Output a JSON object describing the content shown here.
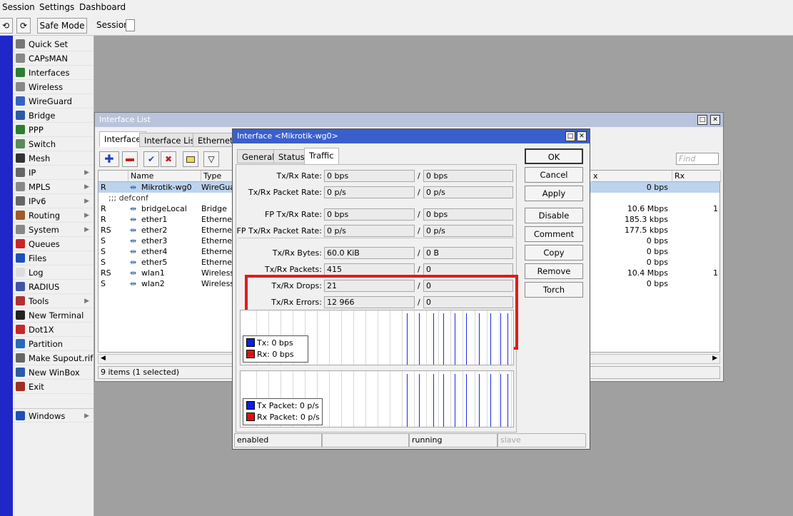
{
  "menu": {
    "session": "Session",
    "settings": "Settings",
    "dashboard": "Dashboard"
  },
  "toolbar": {
    "safe_mode": "Safe Mode",
    "session_label": "Session:"
  },
  "sidebar": {
    "items": [
      {
        "label": "Quick Set",
        "icon": "wand-icon",
        "color": "#777"
      },
      {
        "label": "CAPsMAN",
        "icon": "antenna-icon",
        "color": "#888"
      },
      {
        "label": "Interfaces",
        "icon": "interfaces-icon",
        "color": "#2e7d32"
      },
      {
        "label": "Wireless",
        "icon": "wireless-icon",
        "color": "#888"
      },
      {
        "label": "WireGuard",
        "icon": "wireguard-icon",
        "color": "#3561c4"
      },
      {
        "label": "Bridge",
        "icon": "bridge-icon",
        "color": "#2a5aa8"
      },
      {
        "label": "PPP",
        "icon": "ppp-icon",
        "color": "#2e7d32"
      },
      {
        "label": "Switch",
        "icon": "switch-icon",
        "color": "#5a8a5a"
      },
      {
        "label": "Mesh",
        "icon": "mesh-icon",
        "color": "#333"
      },
      {
        "label": "IP",
        "icon": "ip-icon",
        "color": "#666",
        "arrow": true
      },
      {
        "label": "MPLS",
        "icon": "mpls-icon",
        "color": "#888",
        "arrow": true
      },
      {
        "label": "IPv6",
        "icon": "ipv6-icon",
        "color": "#666",
        "arrow": true
      },
      {
        "label": "Routing",
        "icon": "routing-icon",
        "color": "#a05a2c",
        "arrow": true
      },
      {
        "label": "System",
        "icon": "gear-icon",
        "color": "#888",
        "arrow": true
      },
      {
        "label": "Queues",
        "icon": "queues-icon",
        "color": "#c62828"
      },
      {
        "label": "Files",
        "icon": "folder-icon",
        "color": "#1f4fb8"
      },
      {
        "label": "Log",
        "icon": "log-icon",
        "color": "#ddd"
      },
      {
        "label": "RADIUS",
        "icon": "radius-icon",
        "color": "#4055a8"
      },
      {
        "label": "Tools",
        "icon": "tools-icon",
        "color": "#b03030",
        "arrow": true
      },
      {
        "label": "New Terminal",
        "icon": "terminal-icon",
        "color": "#222"
      },
      {
        "label": "Dot1X",
        "icon": "dot1x-icon",
        "color": "#c62828"
      },
      {
        "label": "Partition",
        "icon": "partition-icon",
        "color": "#2a6ab8"
      },
      {
        "label": "Make Supout.rif",
        "icon": "supout-icon",
        "color": "#666"
      },
      {
        "label": "New WinBox",
        "icon": "winbox-icon",
        "color": "#2a5aa8"
      },
      {
        "label": "Exit",
        "icon": "exit-icon",
        "color": "#a03020"
      }
    ],
    "windows": {
      "label": "Windows",
      "icon": "windows-icon",
      "color": "#1f4fb8"
    }
  },
  "interface_list": {
    "title": "Interface List",
    "tabs": [
      "Interface",
      "Interface List",
      "Ethernet"
    ],
    "find_placeholder": "Find",
    "columns": {
      "flag": "",
      "name": "Name",
      "type": "Type",
      "tx": "x",
      "rx": "Rx"
    },
    "rows": [
      {
        "flag": "R",
        "name": "Mikrotik-wg0",
        "type": "WireGuard",
        "tx": "0 bps",
        "rx": "",
        "selected": true,
        "icon": "wireguard-icon"
      },
      {
        "flag": "",
        "name": ";;; defconf",
        "type": "",
        "tx": "",
        "rx": "",
        "comment": true
      },
      {
        "flag": "R",
        "name": "bridgeLocal",
        "type": "Bridge",
        "tx": "10.6 Mbps",
        "rx": "1",
        "icon": "bridge-icon"
      },
      {
        "flag": "R",
        "name": "ether1",
        "type": "Ethernet",
        "tx": "185.3 kbps",
        "rx": "",
        "icon": "ethernet-icon"
      },
      {
        "flag": "RS",
        "name": "ether2",
        "type": "Ethernet",
        "tx": "177.5 kbps",
        "rx": "",
        "icon": "ethernet-icon"
      },
      {
        "flag": "S",
        "name": "ether3",
        "type": "Ethernet",
        "tx": "0 bps",
        "rx": "",
        "icon": "ethernet-icon"
      },
      {
        "flag": "S",
        "name": "ether4",
        "type": "Ethernet",
        "tx": "0 bps",
        "rx": "",
        "icon": "ethernet-icon"
      },
      {
        "flag": "S",
        "name": "ether5",
        "type": "Ethernet",
        "tx": "0 bps",
        "rx": "",
        "icon": "ethernet-icon"
      },
      {
        "flag": "RS",
        "name": "wlan1",
        "type": "Wireless (",
        "tx": "10.4 Mbps",
        "rx": "1",
        "icon": "wireless-icon"
      },
      {
        "flag": "S",
        "name": "wlan2",
        "type": "Wireless (",
        "tx": "0 bps",
        "rx": "",
        "icon": "wireless-icon"
      }
    ],
    "status": "9 items (1 selected)"
  },
  "dialog": {
    "title": "Interface <Mikrotik-wg0>",
    "tabs": [
      "General",
      "Status",
      "Traffic"
    ],
    "active_tab": "Traffic",
    "fields": [
      {
        "label": "Tx/Rx Rate:",
        "tx": "0 bps",
        "rx": "0 bps"
      },
      {
        "label": "Tx/Rx Packet Rate:",
        "tx": "0 p/s",
        "rx": "0 p/s"
      },
      {
        "label": "FP Tx/Rx Rate:",
        "tx": "0 bps",
        "rx": "0 bps"
      },
      {
        "label": "FP Tx/Rx Packet Rate:",
        "tx": "0 p/s",
        "rx": "0 p/s"
      },
      {
        "label": "Tx/Rx Bytes:",
        "tx": "60.0 KiB",
        "rx": "0 B"
      },
      {
        "label": "Tx/Rx Packets:",
        "tx": "415",
        "rx": "0"
      },
      {
        "label": "Tx/Rx Drops:",
        "tx": "21",
        "rx": "0"
      },
      {
        "label": "Tx/Rx Errors:",
        "tx": "12 966",
        "rx": "0"
      }
    ],
    "separator": "/",
    "buttons": [
      "OK",
      "Cancel",
      "Apply",
      "Disable",
      "Comment",
      "Copy",
      "Remove",
      "Torch"
    ],
    "graph1": {
      "tx_label": "Tx:",
      "tx_value": "0 bps",
      "rx_label": "Rx:",
      "rx_value": "0 bps"
    },
    "graph2": {
      "tx_label": "Tx Packet:",
      "tx_value": "0 p/s",
      "rx_label": "Rx Packet:",
      "rx_value": "0 p/s"
    },
    "status": [
      "enabled",
      "",
      "running",
      "slave"
    ],
    "colors": {
      "tx": "#0a1ee6",
      "rx": "#e01010",
      "highlight": "#e21b1b",
      "title_bar": "#3a5fcd"
    }
  }
}
